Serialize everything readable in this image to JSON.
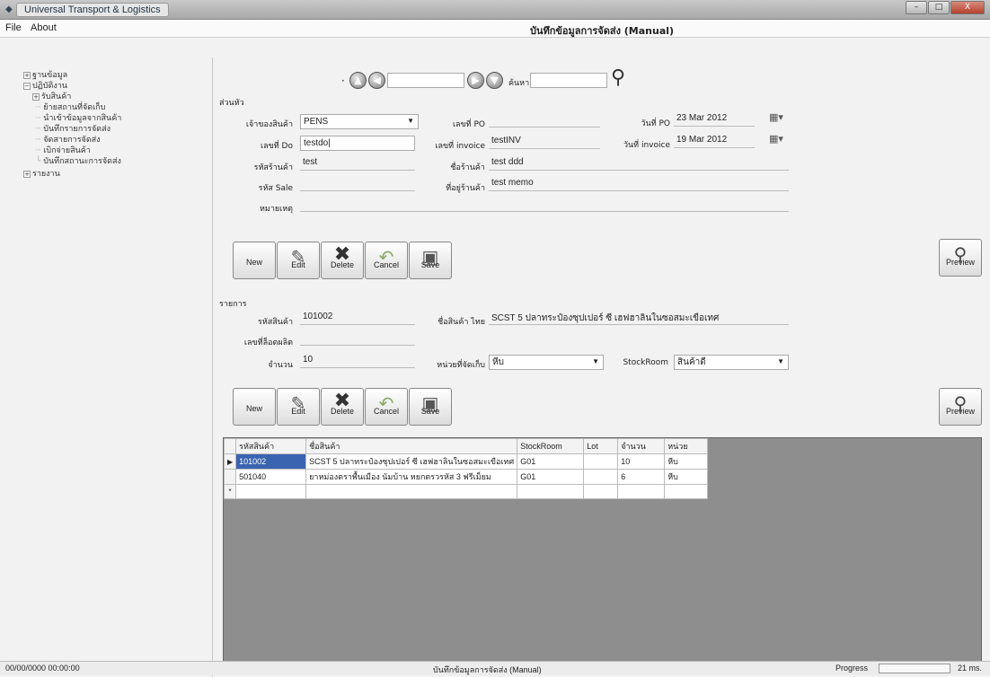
{
  "window": {
    "title": "Universal Transport & Logistics",
    "min": "–",
    "max": "□",
    "close": "X"
  },
  "menu": {
    "file": "File",
    "about": "About"
  },
  "form_title": "บันทึกข้อมูลการจัดส่ง (Manual)",
  "tree": {
    "root1": "ฐานข้อมูล",
    "root2": "ปฏิบัติงาน",
    "child_receive": "รับสินค้า",
    "items": [
      "ย้ายสถานที่จัดเก็บ",
      "นำเข้าข้อมูลจากสินค้า",
      "บันทึกรายการจัดส่ง",
      "จัดสายการจัดส่ง",
      "เบิกจ่ายสินค้า",
      "บันทึกสถานะการจัดส่ง"
    ],
    "root3": "รายงาน"
  },
  "nav": {
    "search_label": "ค้นหา",
    "record_value": "",
    "search_value": ""
  },
  "header_section": {
    "title": "ส่วนหัว",
    "owner_label": "เจ้าของสินค้า",
    "owner_value": "PENS",
    "po_label": "เลขที่ PO",
    "po_value": "",
    "po_date_label": "วันที่ PO",
    "po_date_value": "23 Mar 2012",
    "do_label": "เลขที่ Do",
    "do_value": "testdo|",
    "invoice_label": "เลขที่ invoice",
    "invoice_value": "testINV",
    "inv_date_label": "วันที่ invoice",
    "inv_date_value": "19 Mar 2012",
    "shop_code_label": "รหัสร้านค้า",
    "shop_code_value": "test",
    "shop_name_label": "ชื่อร้านค้า",
    "shop_name_value": "test ddd",
    "sale_label": "รหัส Sale",
    "sale_value": "",
    "shop_addr_label": "ที่อยู่ร้านค้า",
    "shop_addr_value": "test memo",
    "note_label": "หมายเหตุ",
    "note_value": ""
  },
  "buttons": {
    "new": "New",
    "edit": "Edit",
    "delete": "Delete",
    "cancel": "Cancel",
    "save": "Save",
    "preview": "Preview"
  },
  "items_section": {
    "title": "รายการ",
    "product_code_label": "รหัสสินค้า",
    "product_code_value": "101002",
    "product_name_label": "ชื่อสินค้า ไทย",
    "product_name_value": "SCST 5 ปลาทระป๋องซุปเปอร์ ซี เฮฟฮาลินในซอสมะเขือเทศ",
    "lot_label": "เลขที่ล็อตผลิต",
    "lot_value": "",
    "qty_label": "จำนวน",
    "qty_value": "10",
    "unit_label": "หน่วยที่จัดเก็บ",
    "unit_value": "หีบ",
    "stockroom_label": "StockRoom",
    "stockroom_value": "สินค้าดี"
  },
  "grid": {
    "columns": [
      "รหัสสินค้า",
      "ชื่อสินค้า",
      "StockRoom",
      "Lot",
      "จำนวน",
      "หน่วย"
    ],
    "rows": [
      [
        "101002",
        "SCST 5 ปลาทระป๋องซุปเปอร์ ซี เฮฟฮาลินในซอสมะเขือเทศ",
        "G01",
        "",
        "10",
        "หีบ"
      ],
      [
        "501040",
        "ยาหม่องตราพื้นเมือง นัมบ้าน หยกตรวรหัส 3 ฟรีเม็ยม",
        "G01",
        "",
        "6",
        "หีบ"
      ]
    ],
    "current_marker": "▶",
    "new_marker": "*"
  },
  "status": {
    "datetime": "00/00/0000 00:00:00",
    "form": "บันทึกข้อมูลการจัดส่ง (Manual)",
    "progress_label": "Progress",
    "progress": 0,
    "ms": "21 ms."
  }
}
